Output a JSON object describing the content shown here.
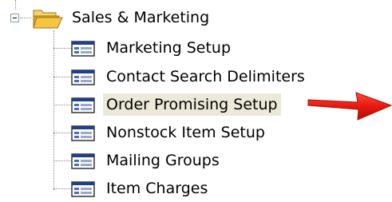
{
  "tree": {
    "root": {
      "label": "Sales & Marketing",
      "icon": "open-folder-icon",
      "expanded": true
    },
    "items": [
      {
        "label": "Marketing Setup",
        "icon": "form-icon"
      },
      {
        "label": "Contact Search Delimiters",
        "icon": "form-icon"
      },
      {
        "label": "Order Promising Setup",
        "icon": "form-icon",
        "selected": true
      },
      {
        "label": "Nonstock Item Setup",
        "icon": "form-icon"
      },
      {
        "label": "Mailing Groups",
        "icon": "form-icon"
      },
      {
        "label": "Item Charges",
        "icon": "form-icon"
      }
    ]
  },
  "colors": {
    "selection_bg": "#ece9d8",
    "arrow": "#e8190f",
    "folder": "#f5c542"
  }
}
